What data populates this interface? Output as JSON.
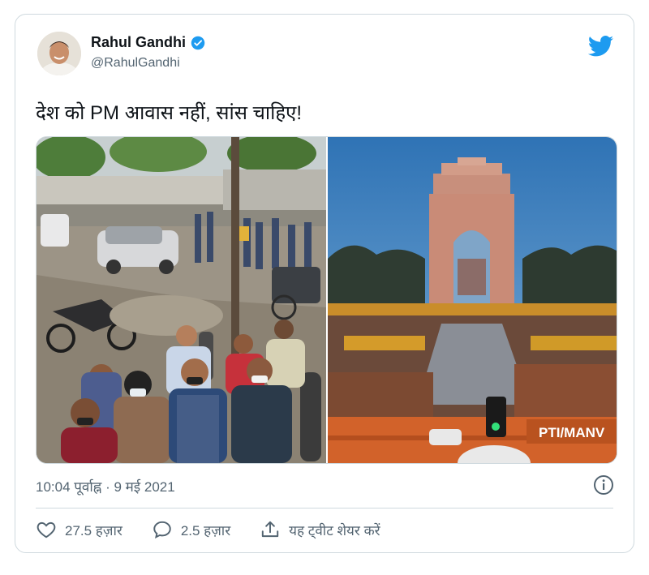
{
  "author": {
    "name": "Rahul Gandhi",
    "handle": "@RahulGandhi",
    "verified": true
  },
  "tweet": {
    "text": "देश को PM आवास नहीं, सांस चाहिए!",
    "timestamp": "10:04 पूर्वाह्न · 9 मई 2021"
  },
  "media": {
    "left_image_caption": "",
    "right_image_caption": "PTI/MANV"
  },
  "actions": {
    "likes": "27.5 हज़ार",
    "replies": "2.5 हज़ार",
    "share": "यह ट्वीट शेयर करें"
  },
  "colors": {
    "brand": "#1d9bf0",
    "text": "#0f1419",
    "secondary": "#536471",
    "border": "#cfd9de"
  },
  "icons": [
    "verified-badge-icon",
    "twitter-bird-icon",
    "info-icon",
    "heart-icon",
    "reply-icon",
    "share-icon"
  ]
}
